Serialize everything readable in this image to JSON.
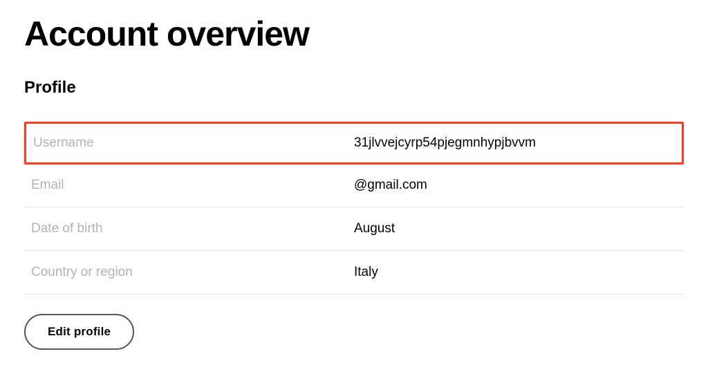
{
  "page": {
    "title": "Account overview"
  },
  "profile": {
    "sectionTitle": "Profile",
    "rows": [
      {
        "label": "Username",
        "value": "31jlvvejcyrp54pjegmnhypjbvvm",
        "highlighted": true
      },
      {
        "label": "Email",
        "value": "@gmail.com",
        "highlighted": false
      },
      {
        "label": "Date of birth",
        "value": "August",
        "highlighted": false
      },
      {
        "label": "Country or region",
        "value": "Italy",
        "highlighted": false
      }
    ],
    "editButtonLabel": "Edit profile"
  }
}
